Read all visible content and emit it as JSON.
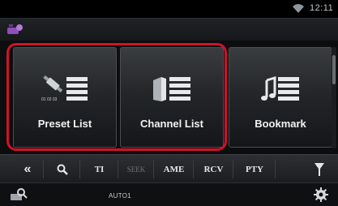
{
  "status": {
    "time": "12:11"
  },
  "tiles": [
    {
      "label": "Preset List",
      "icon": "preset-list-icon"
    },
    {
      "label": "Channel List",
      "icon": "channel-list-icon"
    },
    {
      "label": "Bookmark",
      "icon": "bookmark-icon"
    }
  ],
  "function_bar": {
    "back": "«",
    "search_icon": "search-icon",
    "ti": "TI",
    "seek": "SEEK",
    "ame": "AME",
    "rcv": "RCV",
    "pty": "PTY",
    "antenna_icon": "antenna-icon"
  },
  "info_bar": {
    "channel_name": "AUTO1"
  },
  "colors": {
    "highlight": "#d3102a",
    "app_icon": "#8e4fb6"
  }
}
